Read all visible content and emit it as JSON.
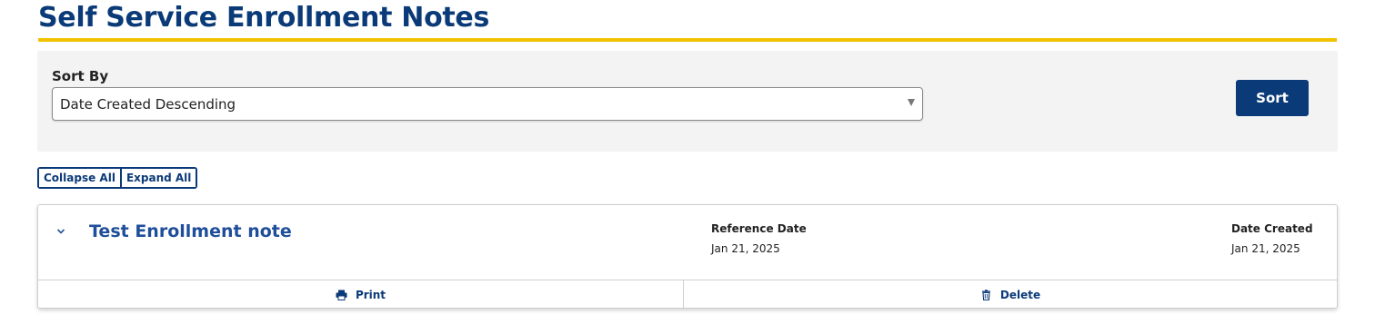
{
  "page": {
    "title": "Self Service Enrollment Notes"
  },
  "sort": {
    "label": "Sort By",
    "selected": "Date Created Descending",
    "button_label": "Sort"
  },
  "toggles": {
    "collapse_all": "Collapse All",
    "expand_all": "Expand All"
  },
  "notes": [
    {
      "title": "Test Enrollment note",
      "reference_date_label": "Reference Date",
      "reference_date": "Jan 21, 2025",
      "date_created_label": "Date Created",
      "date_created": "Jan 21, 2025",
      "print_label": "Print",
      "delete_label": "Delete"
    }
  ],
  "colors": {
    "brand_navy": "#0b3a78",
    "accent_gold": "#f2c200",
    "note_title_blue": "#1f4e9a",
    "panel_gray": "#f3f3f3"
  },
  "icons": {
    "dropdown": "caret-down-icon",
    "collapse": "chevron-down-icon",
    "print": "printer-icon",
    "delete": "trash-icon"
  }
}
